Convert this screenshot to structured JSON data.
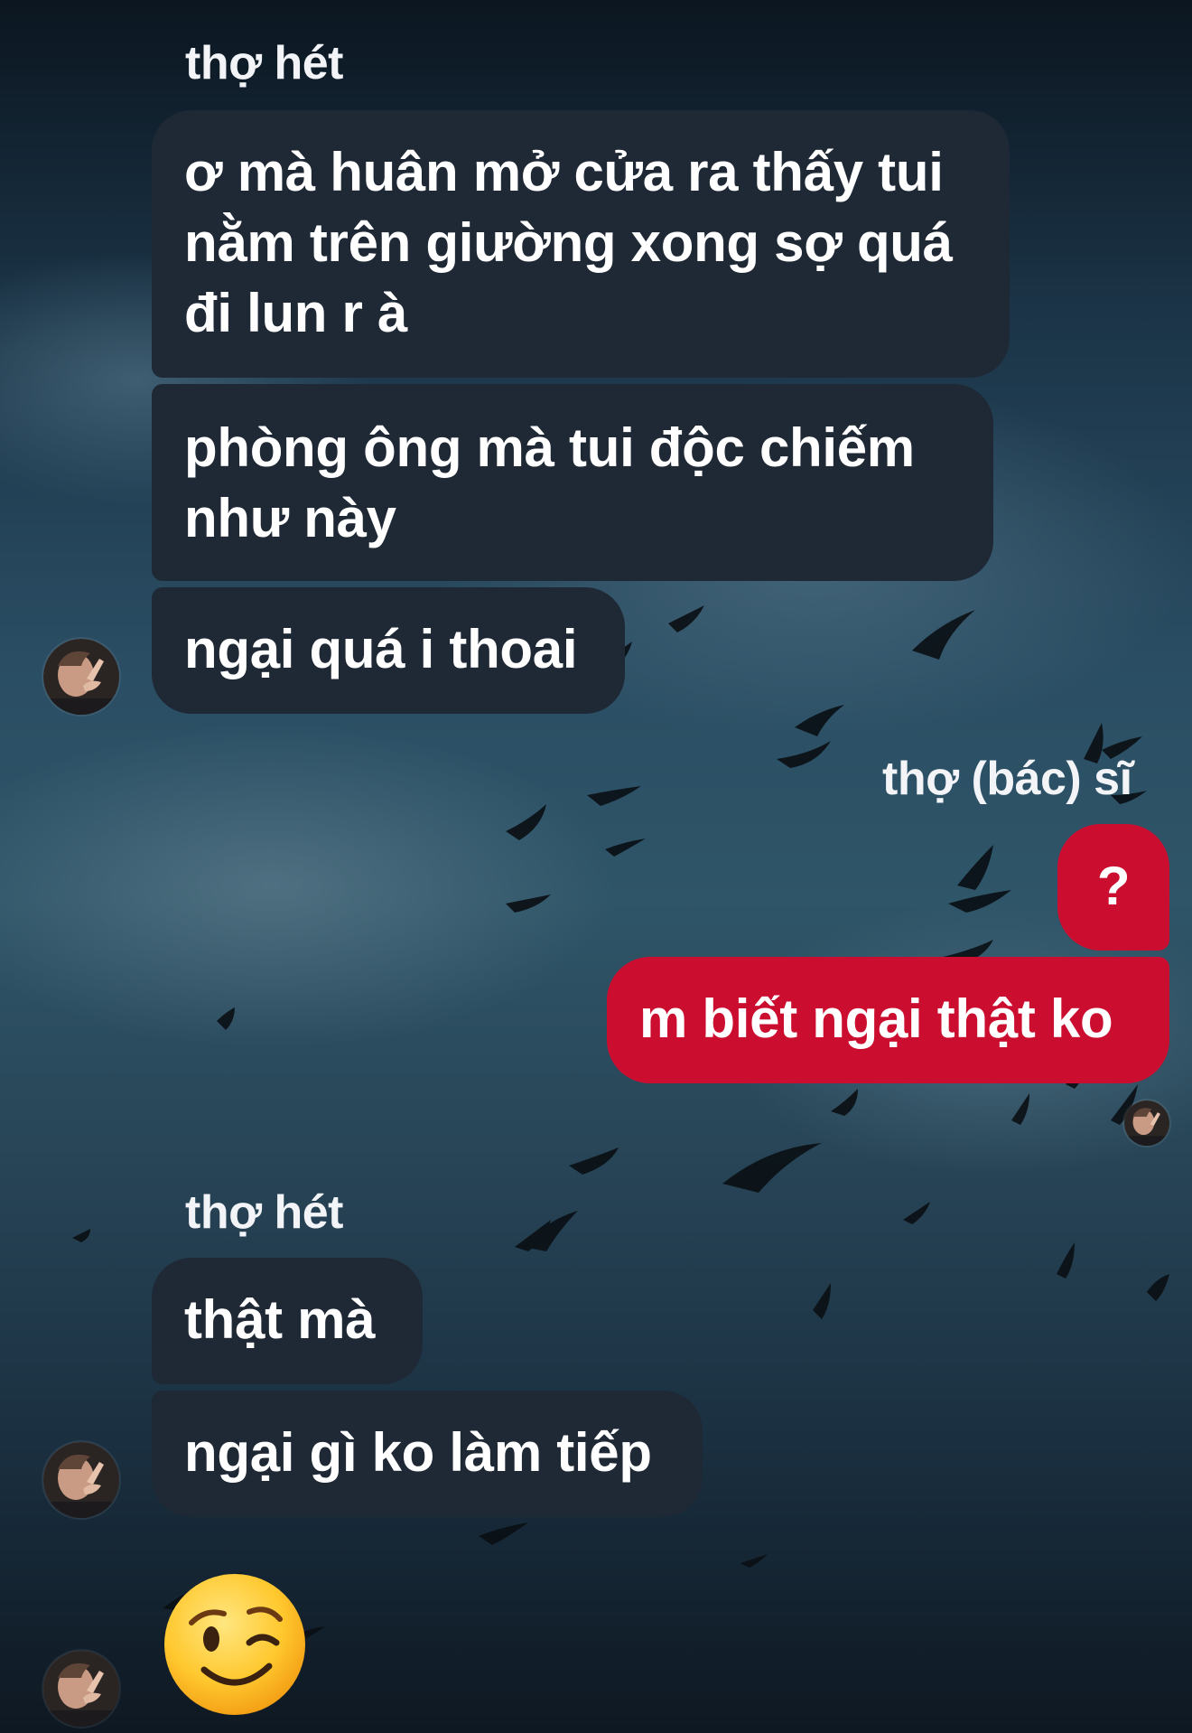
{
  "messages": {
    "group1": {
      "sender": "thợ hét",
      "m1": {
        "line1": "ơ mà huân mở cửa ra thấy tui",
        "line2": "nằm trên giường xong sợ quá",
        "line3": "đi lun r à"
      },
      "m2": {
        "line1": "phòng ông mà tui độc chiếm",
        "line2": "như này"
      },
      "m3": "ngại quá i thoai"
    },
    "group2": {
      "sender": "thợ (bác) sĩ",
      "m1": "?",
      "m2": "m biết ngại thật ko"
    },
    "group3": {
      "sender": "thợ hét",
      "m1": "thật mà",
      "m2": "ngại gì ko làm tiếp",
      "m3_emoji": "winking-face"
    }
  },
  "colors": {
    "incoming_bubble": "#1f2835",
    "outgoing_bubble": "#cb0e30",
    "text": "#ffffff"
  },
  "icons": {
    "avatar": "user-avatar-photo",
    "sticker": "winking-face-emoji"
  }
}
